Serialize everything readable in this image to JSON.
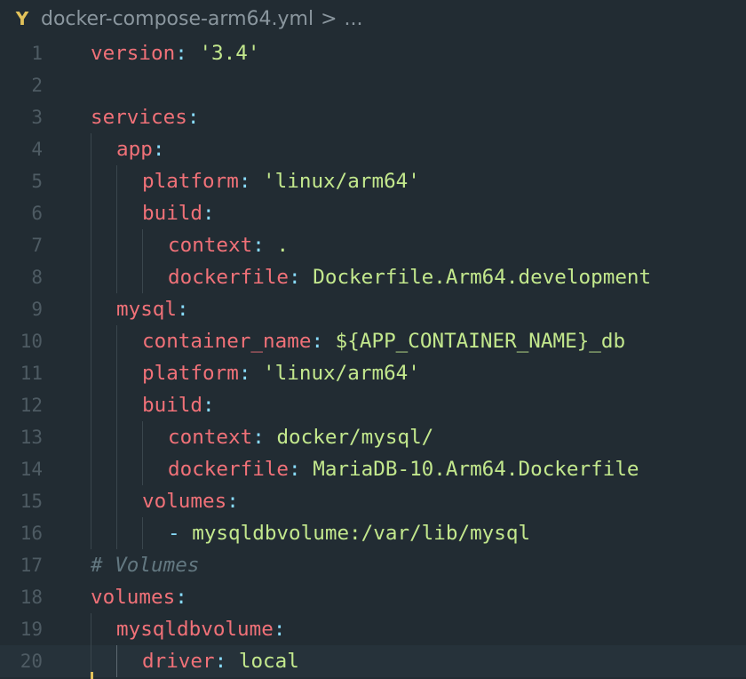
{
  "breadcrumb": {
    "icon": "yaml-file-icon",
    "icon_glyph": "Y",
    "filename": "docker-compose-arm64.yml",
    "separator": ">",
    "more": "..."
  },
  "colors": {
    "background": "#222c33",
    "key": "#f07178",
    "punctuation": "#89ddff",
    "string": "#c3e88d",
    "comment": "#637881",
    "line_number": "#4e5b63"
  },
  "lines": [
    {
      "n": "1",
      "indent": 0,
      "tokens": [
        {
          "t": "version",
          "c": "k"
        },
        {
          "t": ":",
          "c": "p"
        },
        {
          "t": " ",
          "c": ""
        },
        {
          "t": "'3.4'",
          "c": "s"
        }
      ]
    },
    {
      "n": "2",
      "indent": 0,
      "tokens": []
    },
    {
      "n": "3",
      "indent": 0,
      "tokens": [
        {
          "t": "services",
          "c": "k"
        },
        {
          "t": ":",
          "c": "p"
        }
      ]
    },
    {
      "n": "4",
      "indent": 1,
      "tokens": [
        {
          "t": "app",
          "c": "k"
        },
        {
          "t": ":",
          "c": "p"
        }
      ]
    },
    {
      "n": "5",
      "indent": 2,
      "tokens": [
        {
          "t": "platform",
          "c": "k"
        },
        {
          "t": ":",
          "c": "p"
        },
        {
          "t": " ",
          "c": ""
        },
        {
          "t": "'linux/arm64'",
          "c": "s"
        }
      ]
    },
    {
      "n": "6",
      "indent": 2,
      "tokens": [
        {
          "t": "build",
          "c": "k"
        },
        {
          "t": ":",
          "c": "p"
        }
      ]
    },
    {
      "n": "7",
      "indent": 3,
      "tokens": [
        {
          "t": "context",
          "c": "k"
        },
        {
          "t": ":",
          "c": "p"
        },
        {
          "t": " ",
          "c": ""
        },
        {
          "t": ".",
          "c": "s"
        }
      ]
    },
    {
      "n": "8",
      "indent": 3,
      "tokens": [
        {
          "t": "dockerfile",
          "c": "k"
        },
        {
          "t": ":",
          "c": "p"
        },
        {
          "t": " ",
          "c": ""
        },
        {
          "t": "Dockerfile.Arm64.development",
          "c": "s"
        }
      ]
    },
    {
      "n": "9",
      "indent": 1,
      "tokens": [
        {
          "t": "mysql",
          "c": "k"
        },
        {
          "t": ":",
          "c": "p"
        }
      ]
    },
    {
      "n": "10",
      "indent": 2,
      "tokens": [
        {
          "t": "container_name",
          "c": "k"
        },
        {
          "t": ":",
          "c": "p"
        },
        {
          "t": " ",
          "c": ""
        },
        {
          "t": "${APP_CONTAINER_NAME}_db",
          "c": "s"
        }
      ]
    },
    {
      "n": "11",
      "indent": 2,
      "tokens": [
        {
          "t": "platform",
          "c": "k"
        },
        {
          "t": ":",
          "c": "p"
        },
        {
          "t": " ",
          "c": ""
        },
        {
          "t": "'linux/arm64'",
          "c": "s"
        }
      ]
    },
    {
      "n": "12",
      "indent": 2,
      "tokens": [
        {
          "t": "build",
          "c": "k"
        },
        {
          "t": ":",
          "c": "p"
        }
      ]
    },
    {
      "n": "13",
      "indent": 3,
      "tokens": [
        {
          "t": "context",
          "c": "k"
        },
        {
          "t": ":",
          "c": "p"
        },
        {
          "t": " ",
          "c": ""
        },
        {
          "t": "docker/mysql/",
          "c": "s"
        }
      ]
    },
    {
      "n": "14",
      "indent": 3,
      "tokens": [
        {
          "t": "dockerfile",
          "c": "k"
        },
        {
          "t": ":",
          "c": "p"
        },
        {
          "t": " ",
          "c": ""
        },
        {
          "t": "MariaDB-10.Arm64.Dockerfile",
          "c": "s"
        }
      ]
    },
    {
      "n": "15",
      "indent": 2,
      "tokens": [
        {
          "t": "volumes",
          "c": "k"
        },
        {
          "t": ":",
          "c": "p"
        }
      ]
    },
    {
      "n": "16",
      "indent": 3,
      "tokens": [
        {
          "t": "-",
          "c": "dash"
        },
        {
          "t": " ",
          "c": ""
        },
        {
          "t": "mysqldbvolume:/var/lib/mysql",
          "c": "s"
        }
      ]
    },
    {
      "n": "17",
      "indent": 0,
      "tokens": [
        {
          "t": "# Volumes",
          "c": "c"
        }
      ]
    },
    {
      "n": "18",
      "indent": 0,
      "tokens": [
        {
          "t": "volumes",
          "c": "k"
        },
        {
          "t": ":",
          "c": "p"
        }
      ]
    },
    {
      "n": "19",
      "indent": 1,
      "tokens": [
        {
          "t": "mysqldbvolume",
          "c": "k"
        },
        {
          "t": ":",
          "c": "p"
        }
      ]
    },
    {
      "n": "20",
      "indent": 2,
      "current": true,
      "tokens": [
        {
          "t": "driver",
          "c": "k"
        },
        {
          "t": ":",
          "c": "p"
        },
        {
          "t": " ",
          "c": ""
        },
        {
          "t": "local",
          "c": "s"
        }
      ]
    }
  ]
}
